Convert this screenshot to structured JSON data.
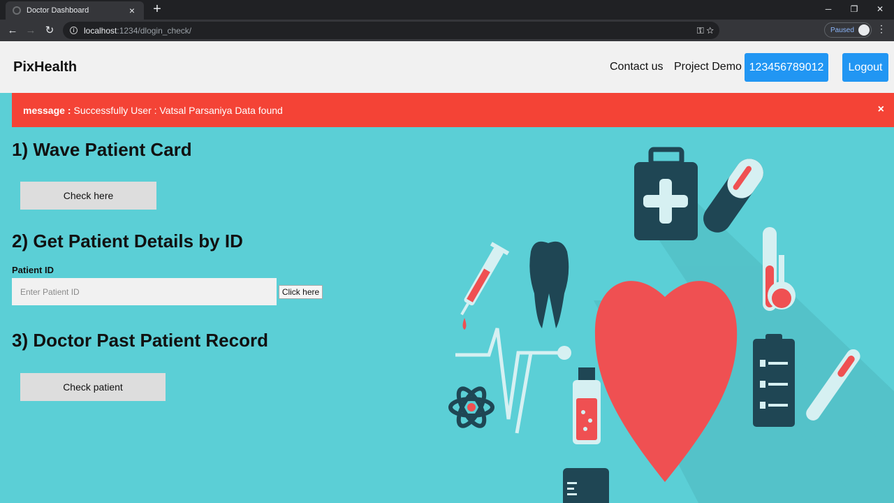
{
  "browser": {
    "tab_title": "Doctor Dashboard",
    "tab_close": "×",
    "new_tab": "+",
    "url_host": "localhost",
    "url_path": ":1234/dlogin_check/",
    "profile_status": "Paused",
    "controls": {
      "minimize": "─",
      "maximize": "❐",
      "close": "✕"
    },
    "nav": {
      "back": "←",
      "forward": "→",
      "reload": "↻"
    }
  },
  "header": {
    "brand": "PixHealth",
    "links": [
      "Contact us",
      "Project Demo"
    ],
    "id_button": "123456789012",
    "logout_button": "Logout"
  },
  "alert": {
    "label": "message :",
    "text": "Successfully User : Vatsal Parsaniya Data found",
    "close": "×",
    "color": "#f44336"
  },
  "sections": {
    "s1": {
      "title": "1) Wave Patient Card",
      "button": "Check here"
    },
    "s2": {
      "title": "2) Get Patient Details by ID",
      "field_label": "Patient ID",
      "placeholder": "Enter Patient ID",
      "button": "Click here"
    },
    "s3": {
      "title": "3) Doctor Past Patient Record",
      "button": "Check patient"
    }
  },
  "colors": {
    "page_bg": "#5bcfd6",
    "accent": "#2196f3",
    "alert": "#f44336",
    "heart": "#ef5052",
    "dark_icon": "#1f4654"
  },
  "illustration_icons": [
    "first-aid-kit-icon",
    "pill-capsule-icon",
    "syringe-icon",
    "tooth-icon",
    "heart-icon",
    "test-tube-icon",
    "flask-icon",
    "clipboard-icon",
    "thermometer-icon",
    "heartbeat-line-icon",
    "atom-icon",
    "medicine-bottle-icon",
    "stethoscope-icon",
    "blood-drop-icon"
  ]
}
